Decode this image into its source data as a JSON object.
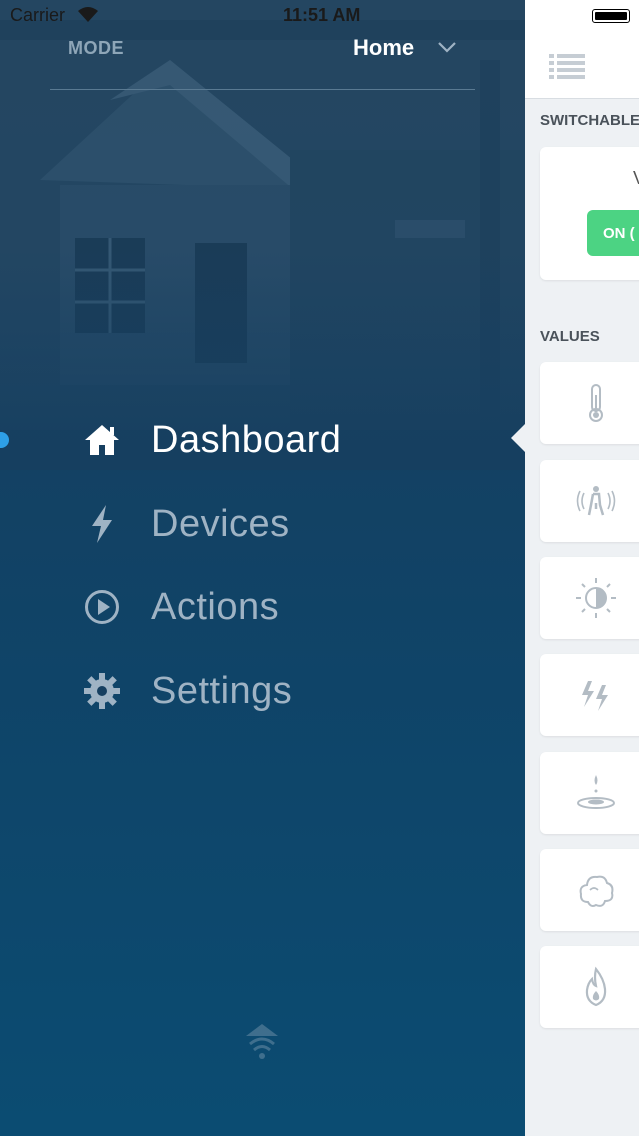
{
  "status_bar": {
    "carrier": "Carrier",
    "time": "11:51 AM"
  },
  "menu": {
    "mode_label": "MODE",
    "mode_value": "Home",
    "items": [
      {
        "label": "Dashboard",
        "icon": "home-icon",
        "active": true
      },
      {
        "label": "Devices",
        "icon": "lightning-icon",
        "active": false
      },
      {
        "label": "Actions",
        "icon": "play-circle-icon",
        "active": false
      },
      {
        "label": "Settings",
        "icon": "gear-icon",
        "active": false
      }
    ],
    "footer_icon": "home-wifi-logo-icon"
  },
  "dashboard": {
    "header_icon": "list-icon",
    "switchables_title": "SWITCHABLE",
    "switchable_card": {
      "title_partial": "V",
      "button_label": "ON ("
    },
    "values_title": "VALUES",
    "value_cards": [
      {
        "icon": "thermometer-icon"
      },
      {
        "icon": "motion-sensor-icon"
      },
      {
        "icon": "brightness-icon"
      },
      {
        "icon": "power-icon"
      },
      {
        "icon": "water-drop-icon"
      },
      {
        "icon": "cloud-smoke-icon"
      },
      {
        "icon": "flame-icon"
      }
    ]
  },
  "colors": {
    "menu_bg": "#163f60",
    "accent_dot": "#2e9fe6",
    "on_button": "#4cd383",
    "panel_bg": "#eef1f4"
  }
}
